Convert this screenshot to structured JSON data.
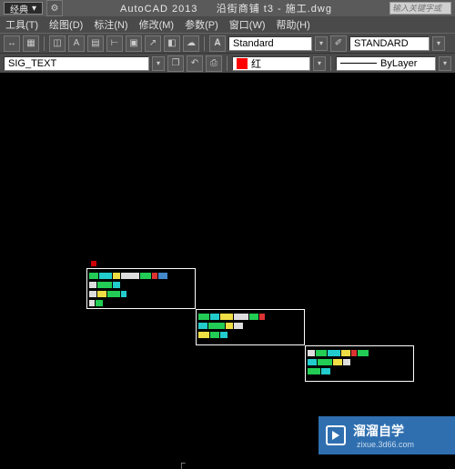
{
  "titlebar": {
    "workspace": "经典",
    "app": "AutoCAD 2013",
    "document": "沿街商铺 t3 - 施工.dwg",
    "search_placeholder": "输入关键字或"
  },
  "menu": {
    "tools": "工具(T)",
    "draw": "绘图(D)",
    "dimension": "标注(N)",
    "modify": "修改(M)",
    "parametric": "参数(P)",
    "window": "窗口(W)",
    "help": "帮助(H)"
  },
  "toolbar1": {
    "textstyle": "Standard",
    "dimstyle": "STANDARD"
  },
  "toolbar2": {
    "layer": "SIG_TEXT",
    "color_label": "红",
    "color_swatch": "#ff0000",
    "linetype": "ByLayer"
  },
  "watermark": {
    "brand": "溜溜自学",
    "url": "zixue.3d66.com"
  },
  "icons": {
    "dropdown": "▾",
    "brush": "✎",
    "pan": "✋"
  }
}
